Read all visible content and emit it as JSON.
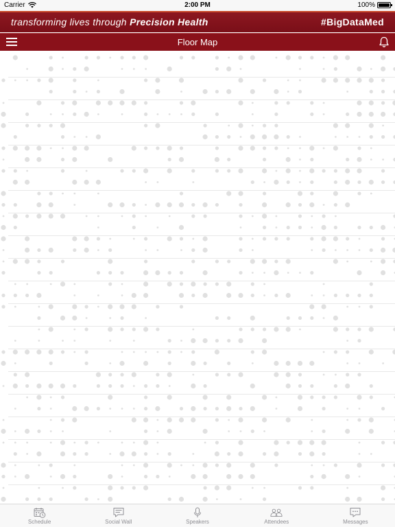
{
  "status_bar": {
    "carrier": "Carrier",
    "time": "2:00 PM",
    "battery": "100%"
  },
  "banner": {
    "tagline_prefix": "transforming lives through ",
    "tagline_bold": "Precision Health",
    "hashtag": "#BigDataMed"
  },
  "navbar": {
    "title": "Floor Map"
  },
  "tabs": [
    {
      "label": "Schedule",
      "icon": "calendar-clock-icon"
    },
    {
      "label": "Social Wall",
      "icon": "speech-bubble-icon"
    },
    {
      "label": "Speakers",
      "icon": "microphone-icon"
    },
    {
      "label": "Attendees",
      "icon": "people-icon"
    },
    {
      "label": "Messages",
      "icon": "chat-bubble-icon"
    }
  ],
  "colors": {
    "brand_red": "#8a111a",
    "accent_orange": "#c9492a",
    "map_dot": "#e0e0e0",
    "map_line": "#e8e8e8",
    "tab_label": "#8e8e93"
  }
}
